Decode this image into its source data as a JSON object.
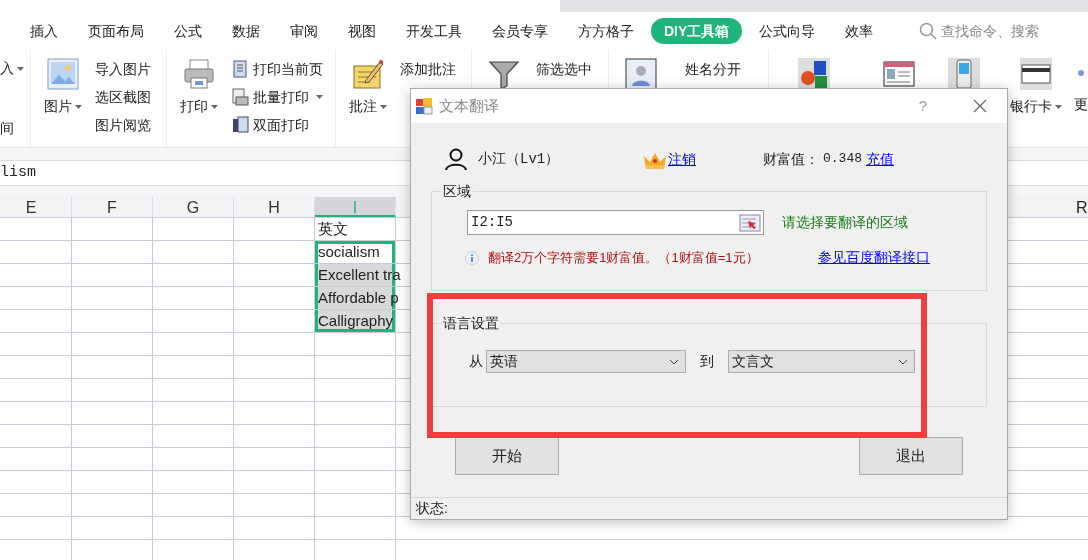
{
  "menu_tabs": [
    {
      "label": "插入",
      "selected": false
    },
    {
      "label": "页面布局",
      "selected": false
    },
    {
      "label": "公式",
      "selected": false
    },
    {
      "label": "数据",
      "selected": false
    },
    {
      "label": "审阅",
      "selected": false
    },
    {
      "label": "视图",
      "selected": false
    },
    {
      "label": "开发工具",
      "selected": false
    },
    {
      "label": "会员专享",
      "selected": false
    },
    {
      "label": "方方格子",
      "selected": false
    },
    {
      "label": "DIY工具箱",
      "selected": true
    },
    {
      "label": "公式向导",
      "selected": false
    },
    {
      "label": "效率",
      "selected": false
    }
  ],
  "search": {
    "placeholder": "查找命令、搜索"
  },
  "ribbon": {
    "cut_labels": [
      "入",
      "间"
    ],
    "groups": [
      {
        "large": {
          "label": "图片",
          "dropdown": true
        },
        "small": [
          {
            "label": "导入图片"
          },
          {
            "label": "选区截图"
          },
          {
            "label": "图片阅览"
          }
        ]
      },
      {
        "large": {
          "label": "打印",
          "dropdown": true
        },
        "small": [
          {
            "label": "打印当前页",
            "dropdown": false
          },
          {
            "label": "批量打印",
            "dropdown": true
          },
          {
            "label": "双面打印",
            "dropdown": false
          }
        ]
      },
      {
        "large": {
          "label": "批注",
          "dropdown": true
        },
        "small": [
          {
            "label": "添加批注"
          }
        ]
      },
      {
        "small": [
          {
            "label": "筛选选中"
          }
        ]
      },
      {
        "small": [
          {
            "label": "姓名分开"
          }
        ]
      }
    ],
    "tools": [
      {
        "label": "银行卡",
        "dropdown": true
      },
      {
        "label": "更"
      }
    ]
  },
  "formula_bar": {
    "value": "lism"
  },
  "sheet": {
    "columns": [
      {
        "label": "E",
        "selected": false
      },
      {
        "label": "F",
        "selected": false
      },
      {
        "label": "G",
        "selected": false
      },
      {
        "label": "H",
        "selected": false
      },
      {
        "label": "I",
        "selected": true
      }
    ],
    "far_columns": [
      {
        "label": "R"
      }
    ],
    "column_I": [
      {
        "text": "英文",
        "selected": false,
        "shaded": false
      },
      {
        "text": "socialism",
        "selected": true,
        "shaded": false
      },
      {
        "text": "Excellent tra",
        "selected": true,
        "shaded": true
      },
      {
        "text": "Affordable p",
        "selected": true,
        "shaded": true
      },
      {
        "text": "Calligraphy",
        "selected": true,
        "shaded": true
      }
    ]
  },
  "dialog": {
    "title": "文本翻译",
    "help": "?",
    "user": {
      "name": "小江（Lv1）",
      "logout": "注销",
      "wealth_label": "财富值：",
      "wealth": "0.348",
      "recharge": "充值"
    },
    "range_group": {
      "legend": "区域",
      "value": "I2:I5",
      "hint": "请选择要翻译的区域",
      "notice": "翻译2万个字符需要1财富值。（1财富值=1元）",
      "link": "参见百度翻译接口"
    },
    "language_group": {
      "legend": "语言设置",
      "from_label": "从",
      "from": "英语",
      "to_label": "到",
      "to": "文言文"
    },
    "buttons": [
      "开始",
      "退出"
    ],
    "status": "状态:"
  }
}
